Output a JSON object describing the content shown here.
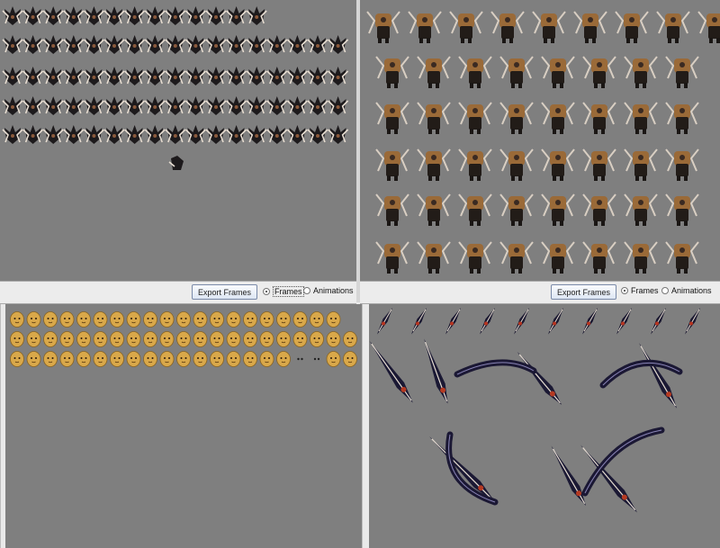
{
  "panels": {
    "top_left": {
      "export_label": "Export Frames",
      "frames_label": "Frames",
      "animations_label": "Animations",
      "selected": "Frames"
    },
    "top_right": {
      "export_label": "Export Frames",
      "frames_label": "Frames",
      "animations_label": "Animations",
      "selected": "Frames"
    }
  },
  "colors": {
    "canvas": "#7f7f7f",
    "toolbar": "#ececec"
  },
  "icons": [
    "radio-selected-icon",
    "radio-unselected-icon"
  ]
}
